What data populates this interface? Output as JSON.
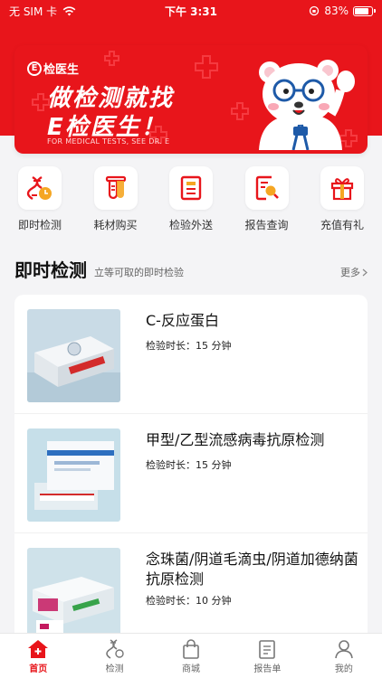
{
  "status_bar": {
    "carrier": "无 SIM 卡",
    "time": "下午 3:31",
    "battery": "83%",
    "battery_level": 0.83
  },
  "banner": {
    "logo_text": "检医生",
    "slogan_line1": "做检测就找",
    "slogan_line2": "E检医生！",
    "subtitle": "FOR MEDICAL TESTS, SEE DR. E"
  },
  "quick_menu": [
    {
      "label": "即时检测",
      "icon": "dna-clock-icon"
    },
    {
      "label": "耗材购买",
      "icon": "test-tube-icon"
    },
    {
      "label": "检验外送",
      "icon": "document-icon"
    },
    {
      "label": "报告查询",
      "icon": "report-search-icon"
    },
    {
      "label": "充值有礼",
      "icon": "gift-icon"
    }
  ],
  "section": {
    "title": "即时检测",
    "desc": "立等可取的即时检验",
    "more": "更多"
  },
  "tests": [
    {
      "name": "C-反应蛋白",
      "duration": "检验时长：15 分钟"
    },
    {
      "name": "甲型/乙型流感病毒抗原检测",
      "duration": "检验时长：15 分钟"
    },
    {
      "name": "念珠菌/阴道毛滴虫/阴道加德纳菌抗原检测",
      "duration": "检验时长：10 分钟"
    }
  ],
  "tabs": [
    {
      "label": "首页",
      "icon": "home-icon",
      "active": true
    },
    {
      "label": "检测",
      "icon": "dna-icon",
      "active": false
    },
    {
      "label": "商城",
      "icon": "bag-icon",
      "active": false
    },
    {
      "label": "报告单",
      "icon": "report-icon",
      "active": false
    },
    {
      "label": "我的",
      "icon": "user-icon",
      "active": false
    }
  ],
  "colors": {
    "brand_red": "#e8151b",
    "icon_orange": "#f5a623"
  }
}
